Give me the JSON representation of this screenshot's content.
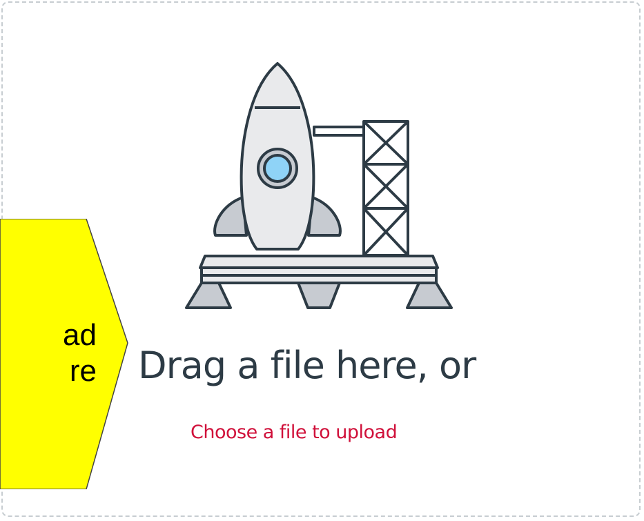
{
  "dropzone": {
    "heading": "Drag a file here, or",
    "link_label": "Choose a file to upload"
  },
  "callout": {
    "line1": "ad",
    "line2": "re",
    "color": "#ffff00"
  },
  "colors": {
    "link": "#d0103a",
    "heading": "#2d3b45",
    "dashed_border": "#c7cdd1"
  },
  "icons": {
    "illustration": "rocket-launchpad-icon"
  }
}
